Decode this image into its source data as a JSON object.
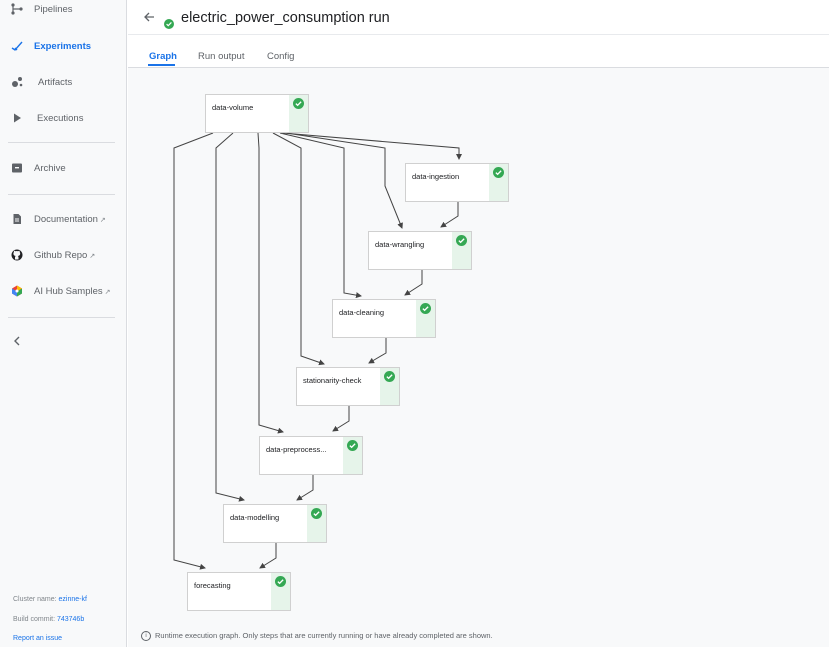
{
  "sidebar": {
    "items": [
      {
        "label": "Pipelines",
        "icon": "pipelines-icon"
      },
      {
        "label": "Experiments",
        "icon": "experiments-icon",
        "active": true
      },
      {
        "label": "Artifacts",
        "icon": "artifacts-icon"
      },
      {
        "label": "Executions",
        "icon": "executions-icon"
      },
      {
        "label": "Archive",
        "icon": "archive-icon"
      },
      {
        "label": "Documentation",
        "icon": "document-icon",
        "external": true
      },
      {
        "label": "Github Repo",
        "icon": "github-icon",
        "external": true
      },
      {
        "label": "AI Hub Samples",
        "icon": "ai-hub-icon",
        "external": true
      }
    ],
    "cluster_label": "Cluster name:",
    "cluster_value": "ezinne-kf",
    "build_label": "Build commit:",
    "build_value": "743746b",
    "report_issue": "Report an issue"
  },
  "header": {
    "run_title": "electric_power_consumption run",
    "status": "success"
  },
  "tabs": [
    "Graph",
    "Run output",
    "Config"
  ],
  "active_tab": "Graph",
  "graph": {
    "nodes": [
      {
        "label": "data-volume",
        "status": "success"
      },
      {
        "label": "data-ingestion",
        "status": "success"
      },
      {
        "label": "data-wrangling",
        "status": "success"
      },
      {
        "label": "data-cleaning",
        "status": "success"
      },
      {
        "label": "stationarity-check",
        "status": "success"
      },
      {
        "label": "data-preprocess...",
        "status": "success"
      },
      {
        "label": "data-modelling",
        "status": "success"
      },
      {
        "label": "forecasting",
        "status": "success"
      }
    ],
    "note": "Runtime execution graph. Only steps that are currently running or have already completed are shown."
  },
  "colors": {
    "accent": "#1a73e8",
    "success": "#34a853",
    "success_bg": "#e6f4ea"
  }
}
